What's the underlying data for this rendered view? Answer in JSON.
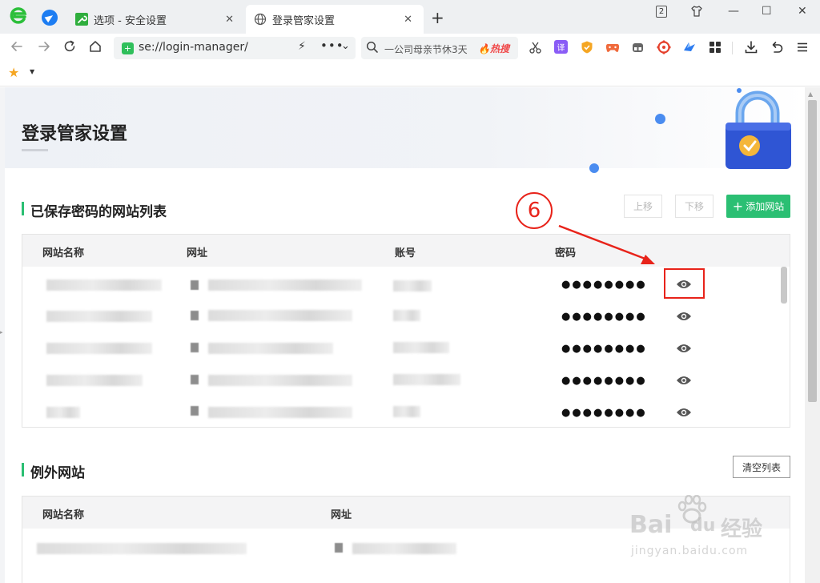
{
  "browser": {
    "tabs": [
      {
        "label": "选项 - 安全设置",
        "close": "✕"
      },
      {
        "label": "登录管家设置",
        "close": "✕"
      }
    ],
    "new_tab": "+",
    "window_controls": {
      "tab_count": "2",
      "minimize": "—",
      "maximize": "☐",
      "close": "✕"
    },
    "address": {
      "url": "se://login-manager/"
    },
    "search": {
      "query": "一公司母亲节休3天",
      "hot_label": "热搜"
    },
    "extensions": [
      {
        "icon": "scissors-icon",
        "color": "#444444"
      },
      {
        "icon": "translate-icon",
        "color": "#8a5cf6",
        "glyph": "译"
      },
      {
        "icon": "shield-ext-icon",
        "color": "#f5a623"
      },
      {
        "icon": "gamepad-icon",
        "color": "#f06a3c"
      },
      {
        "icon": "capsule-icon",
        "color": "#666666"
      },
      {
        "icon": "wheel-icon",
        "color": "#e5412d"
      },
      {
        "icon": "bird-icon",
        "color": "#2b7bf0"
      },
      {
        "icon": "grid-apps-icon",
        "color": "#333333"
      }
    ]
  },
  "page": {
    "title": "登录管家设置",
    "saved_section": {
      "title": "已保存密码的网站列表",
      "move_up": "上移",
      "move_down": "下移",
      "add_site": "添加网站",
      "columns": [
        "网站名称",
        "网址",
        "账号",
        "密码"
      ],
      "rows": [
        {
          "password": "●●●●●●●●"
        },
        {
          "password": "●●●●●●●●"
        },
        {
          "password": "●●●●●●●●"
        },
        {
          "password": "●●●●●●●●"
        },
        {
          "password": "●●●●●●●●"
        }
      ]
    },
    "exception_section": {
      "title": "例外网站",
      "clear_list": "清空列表",
      "columns": [
        "网站名称",
        "网址"
      ]
    }
  },
  "annotation": {
    "step": "6",
    "color": "#e8231a"
  },
  "watermark": {
    "line1": "Bai",
    "line1b": "du",
    "line1c": "经验",
    "line2": "jingyan.baidu.com"
  },
  "colors": {
    "accent_green": "#2bbf73",
    "annotation_red": "#e8231a",
    "link_blue": "#1d7df2"
  }
}
